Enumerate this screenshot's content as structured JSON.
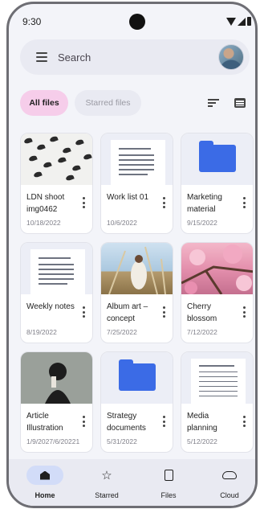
{
  "status_bar": {
    "time": "9:30"
  },
  "search": {
    "label": "Search"
  },
  "filters": {
    "all": "All files",
    "starred": "Starred files"
  },
  "files": [
    {
      "name": "LDN shoot img0462",
      "date": "10/18/2022",
      "thumb": "birds-photo"
    },
    {
      "name": "Work list 01",
      "date": "10/6/2022",
      "thumb": "document"
    },
    {
      "name": "Marketing material",
      "date": "9/15/2022",
      "thumb": "folder-icon"
    },
    {
      "name": "Weekly notes",
      "date": "8/19/2022",
      "thumb": "document"
    },
    {
      "name": "Album art – concept",
      "date": "7/25/2022",
      "thumb": "album-photo"
    },
    {
      "name": "Cherry blossom",
      "date": "7/12/2022",
      "thumb": "cherry-photo"
    },
    {
      "name": "Article Illustration",
      "date": "1/9/2027/6/20221",
      "thumb": "article-photo"
    },
    {
      "name": "Strategy documents",
      "date": "5/31/2022",
      "thumb": "folder-icon"
    },
    {
      "name": "Media planning",
      "date": "5/12/2022",
      "thumb": "spreadsheet"
    }
  ],
  "bottom_nav": {
    "home": "Home",
    "starred": "Starred",
    "files": "Files",
    "cloud": "Cloud"
  },
  "colors": {
    "accent_chip": "#f6cdea",
    "folder": "#3b6be6",
    "nav_active": "#d2dcf8"
  }
}
